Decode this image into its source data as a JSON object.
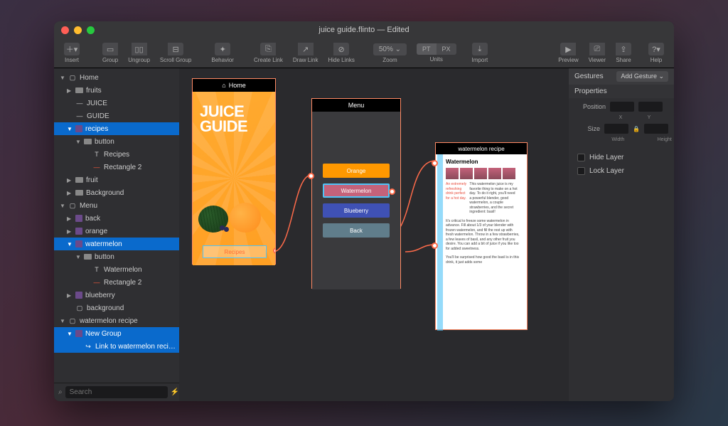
{
  "title": "juice guide.flinto — Edited",
  "toolbar": {
    "insert": "Insert",
    "group": "Group",
    "ungroup": "Ungroup",
    "scrollGroup": "Scroll Group",
    "behavior": "Behavior",
    "createLink": "Create Link",
    "drawLink": "Draw Link",
    "hideLinks": "Hide Links",
    "zoom": "Zoom",
    "zoomValue": "50% ⌄",
    "units": "Units",
    "unitPT": "PT",
    "unitPX": "PX",
    "import": "Import",
    "preview": "Preview",
    "viewer": "Viewer",
    "share": "Share",
    "help": "Help"
  },
  "tree": {
    "home": "Home",
    "fruits": "fruits",
    "juice": "JUICE",
    "guide": "GUIDE",
    "recipes": "recipes",
    "button1": "button",
    "recipesLayer": "Recipes",
    "rect2a": "Rectangle 2",
    "fruit": "fruit",
    "background1": "Background",
    "menu": "Menu",
    "back": "back",
    "orange": "orange",
    "watermelon": "watermelon",
    "button2": "button",
    "watermelonLayer": "Watermelon",
    "rect2b": "Rectangle 2",
    "blueberry": "blueberry",
    "background2": "background",
    "watermelonRecipe": "watermelon recipe",
    "newGroup": "New Group",
    "linkTo": "Link to watermelon reci…"
  },
  "searchPlaceholder": "Search",
  "screens": {
    "home": "Home",
    "menu": "Menu",
    "recipe": "watermelon recipe"
  },
  "juiceLine1": "JUICE",
  "juiceLine2": "GUIDE",
  "recipesBtn": "Recipes",
  "menuButtons": {
    "orange": "Orange",
    "watermelon": "Watermelon",
    "blueberry": "Blueberry",
    "back": "Back"
  },
  "recipe": {
    "title": "Watermelon",
    "redLabel": "An extremely refreshing drink perfect for a hot day.",
    "p1": "This watermelon juice is my favorite thing to make on a hot day. To do it right, you'll need a powerful blender, good watermelon, a couple strawberries, and the secret ingredient: basil!",
    "p2": "It's critical to freeze some watermelon in advance. Fill about 1/3 of your blender with frozen watermelon, and fill the rest up with fresh watermelon. Throw in a few strawberries, a few leaves of basil, and any other fruit you desire. You can add a bit of juice if you like too for added sweetness.",
    "p3": "You'll be surprised how good the basil is in this drink, it just adds some"
  },
  "inspector": {
    "gestures": "Gestures",
    "addGesture": "Add Gesture ⌄",
    "properties": "Properties",
    "position": "Position",
    "size": "Size",
    "x": "X",
    "y": "Y",
    "width": "Width",
    "height": "Height",
    "hideLayer": "Hide Layer",
    "lockLayer": "Lock Layer"
  }
}
